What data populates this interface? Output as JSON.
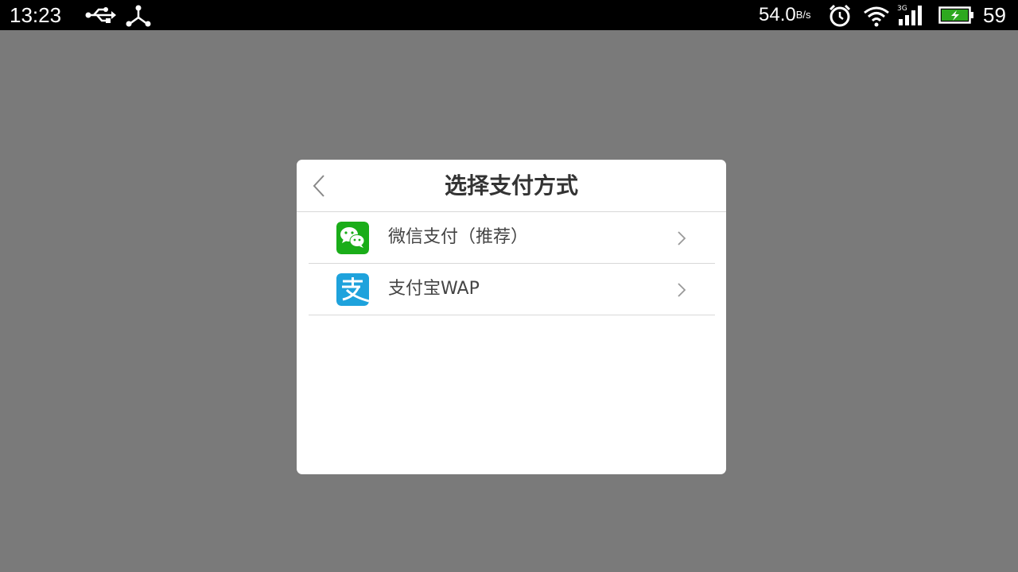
{
  "status_bar": {
    "time": "13:23",
    "icons_left": [
      "usb-icon",
      "usb-debug-icon"
    ],
    "net_speed": "54.0",
    "net_speed_unit": "B/s",
    "icons_right": [
      "alarm-icon",
      "wifi-icon",
      "signal-3g-icon",
      "battery-charging-icon"
    ],
    "battery_level": "59"
  },
  "dialog": {
    "title": "选择支付方式",
    "back_icon": "chevron-left-icon",
    "items": [
      {
        "label": "微信支付（推荐）",
        "icon": "wechat-pay-icon",
        "icon_color": "#1aad19"
      },
      {
        "label": "支付宝WAP",
        "icon": "alipay-icon",
        "icon_color": "#1ea2dc"
      }
    ]
  },
  "colors": {
    "overlay": "#7a7a7a",
    "dialog_bg": "#ffffff",
    "divider": "#d8d8d8",
    "battery_fill": "#2ea81f"
  }
}
